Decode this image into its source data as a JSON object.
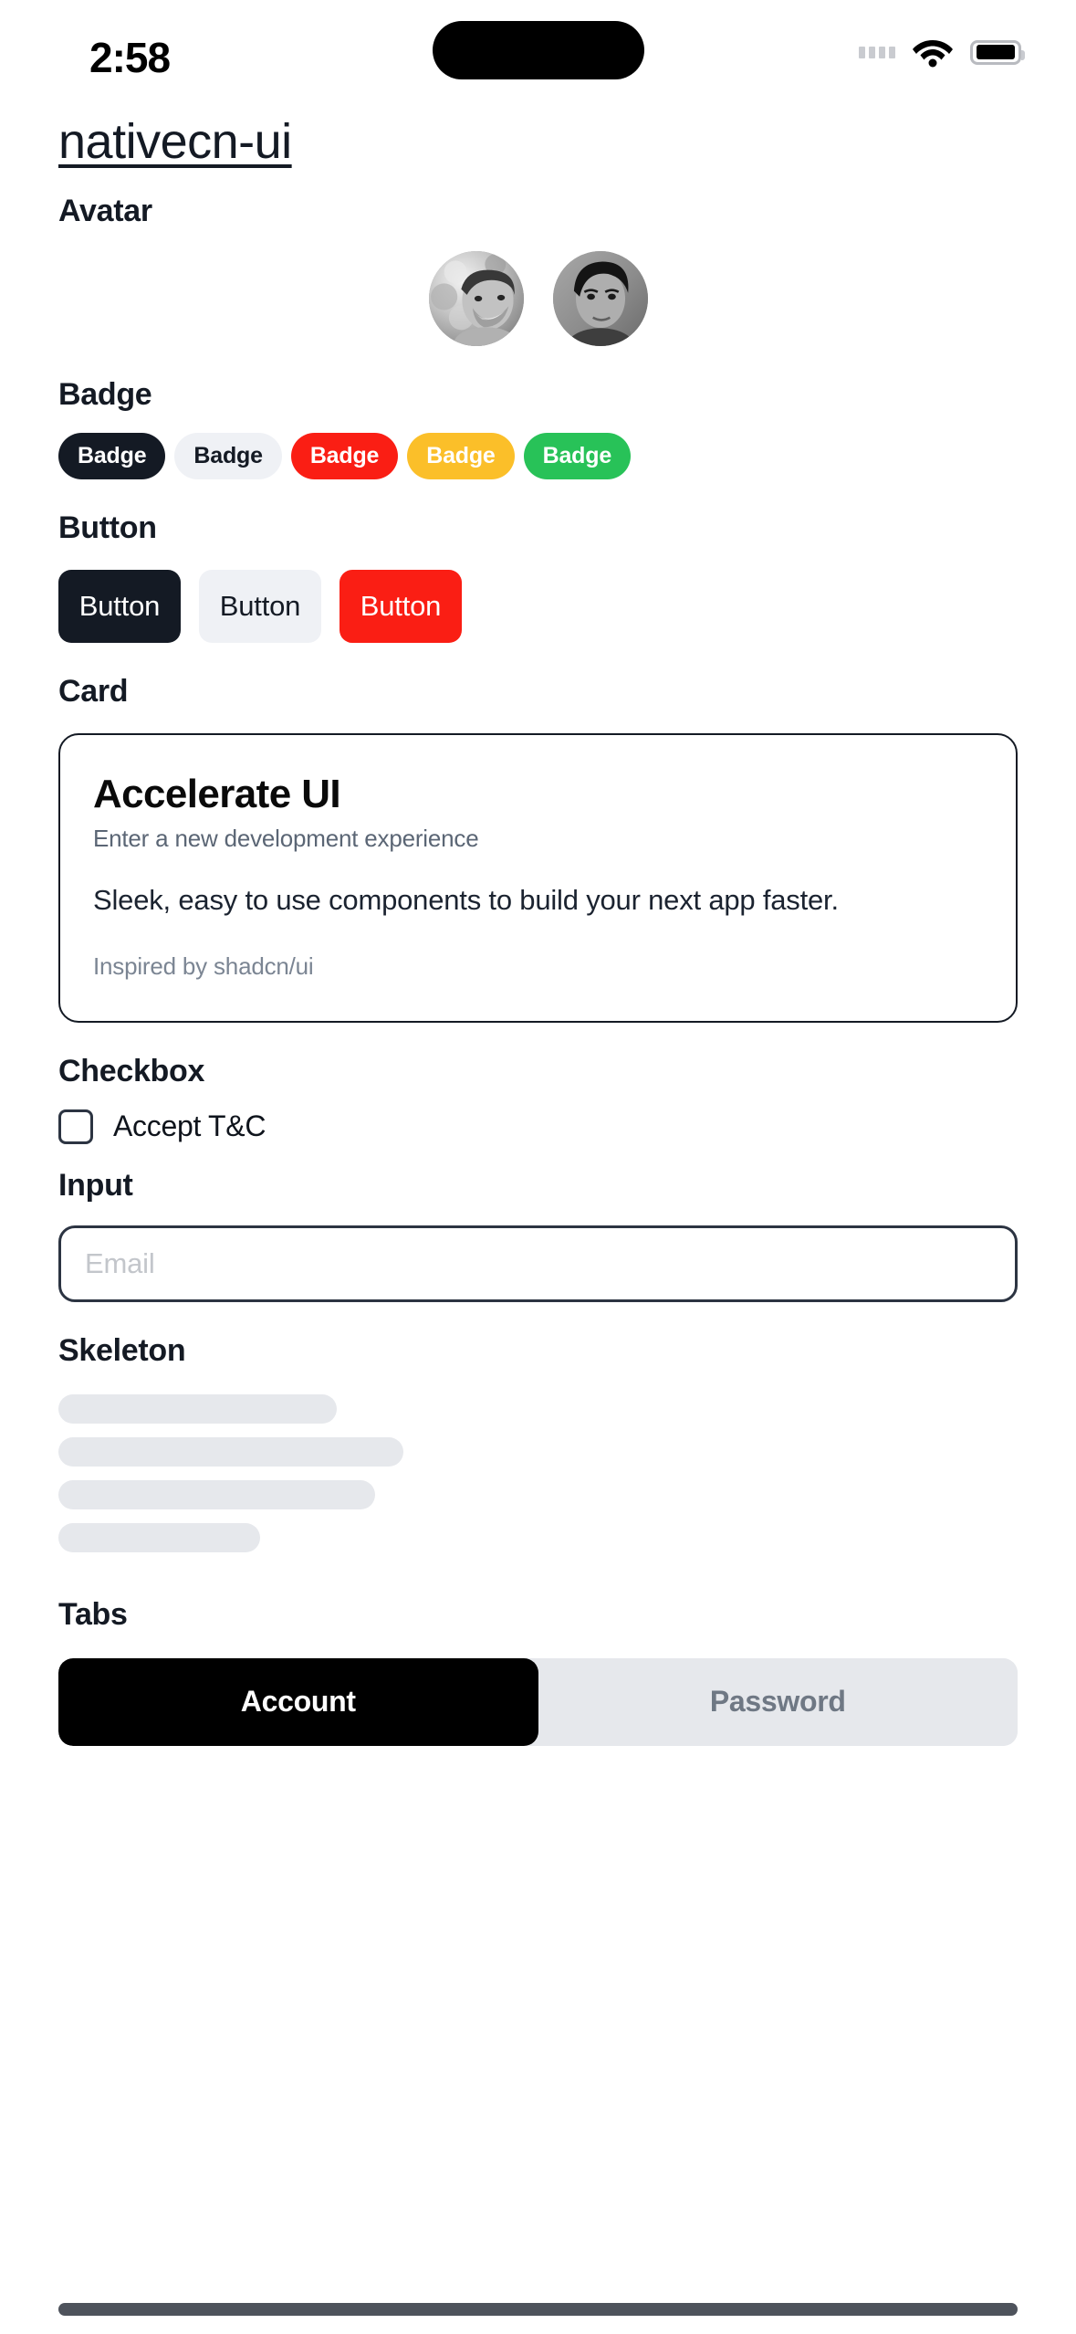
{
  "status_bar": {
    "time": "2:58",
    "signal_icon": "signal-dots-icon",
    "wifi_icon": "wifi-icon",
    "battery_icon": "battery-icon"
  },
  "header": {
    "app_title": "nativecn-ui"
  },
  "sections": {
    "avatar": {
      "title": "Avatar",
      "avatars": [
        {
          "name": "avatar-one",
          "alt": "man smiling outdoors"
        },
        {
          "name": "avatar-two",
          "alt": "man portrait"
        }
      ]
    },
    "badge": {
      "title": "Badge",
      "items": [
        {
          "label": "Badge",
          "variant": "default",
          "bg": "#141a24",
          "fg": "#ffffff"
        },
        {
          "label": "Badge",
          "variant": "secondary",
          "bg": "#eff1f5",
          "fg": "#141a24"
        },
        {
          "label": "Badge",
          "variant": "destructive",
          "bg": "#fa1e14",
          "fg": "#ffffff"
        },
        {
          "label": "Badge",
          "variant": "warning",
          "bg": "#fbbf29",
          "fg": "#ffffff"
        },
        {
          "label": "Badge",
          "variant": "success",
          "bg": "#28c258",
          "fg": "#ffffff"
        }
      ]
    },
    "button": {
      "title": "Button",
      "items": [
        {
          "label": "Button",
          "variant": "default"
        },
        {
          "label": "Button",
          "variant": "secondary"
        },
        {
          "label": "Button",
          "variant": "destructive"
        }
      ]
    },
    "card": {
      "title": "Card",
      "heading": "Accelerate UI",
      "subheading": "Enter a new development experience",
      "body": "Sleek, easy to use components to build your next app faster.",
      "footer": "Inspired by shadcn/ui"
    },
    "checkbox": {
      "title": "Checkbox",
      "label": "Accept T&C",
      "checked": false
    },
    "input": {
      "title": "Input",
      "placeholder": "Email",
      "value": ""
    },
    "skeleton": {
      "title": "Skeleton",
      "bars": [
        {
          "width": "29%"
        },
        {
          "width": "36%"
        },
        {
          "width": "33%"
        },
        {
          "width": "21%"
        }
      ]
    },
    "tabs": {
      "title": "Tabs",
      "items": [
        {
          "label": "Account",
          "active": true
        },
        {
          "label": "Password",
          "active": false
        }
      ]
    }
  },
  "colors": {
    "foreground": "#141a24",
    "muted": "#7b8593",
    "destructive": "#fa1e14",
    "warning": "#fbbf29",
    "success": "#28c258",
    "secondary": "#eff1f5",
    "skeleton": "#e6e8ec"
  }
}
